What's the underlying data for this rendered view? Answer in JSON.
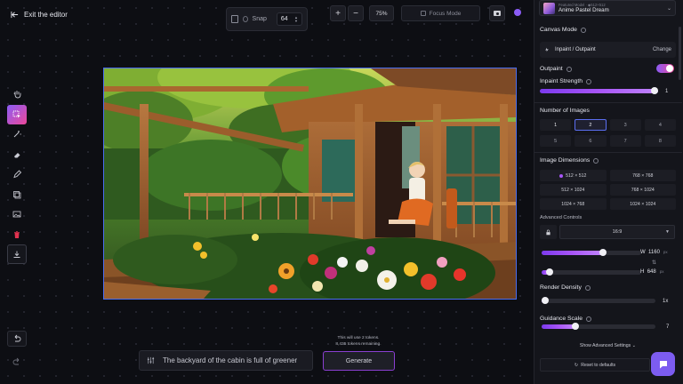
{
  "topbar": {
    "exit_label": "Exit the editor",
    "snap_label": "Snap",
    "snap_value": "64",
    "zoom_in": "+",
    "zoom_out": "−",
    "zoom_level": "75%",
    "focus_mode": "Focus Mode"
  },
  "model": {
    "meta": "Featured Model · ◆512×512",
    "name": "Anime Pastel Dream"
  },
  "canvas_mode": {
    "title": "Canvas Mode",
    "mode": "Inpaint / Outpaint",
    "change": "Change"
  },
  "outpaint": {
    "label": "Outpaint",
    "enabled": true
  },
  "inpaint_strength": {
    "label": "Inpaint Strength",
    "value": "1",
    "level": 1.0
  },
  "num_images": {
    "title": "Number of Images",
    "options": [
      "1",
      "2",
      "3",
      "4",
      "5",
      "6",
      "7",
      "8"
    ],
    "selected": "2"
  },
  "image_dims": {
    "title": "Image Dimensions",
    "options": [
      "512 × 512",
      "768 × 768",
      "512 × 1024",
      "768 × 1024",
      "1024 × 768",
      "1024 × 1024"
    ],
    "selected": "512 × 512"
  },
  "advanced": {
    "label": "Advanced Controls",
    "ratio": "16:9",
    "width_label": "W",
    "width_value": "1160",
    "height_label": "H",
    "height_value": "648",
    "unit": "px",
    "width_level": 0.62,
    "height_level": 0.08
  },
  "render_density": {
    "label": "Render Density",
    "value": "1x",
    "level": 0.0
  },
  "guidance_scale": {
    "label": "Guidance Scale",
    "value": "7",
    "level": 0.3
  },
  "show_advanced": "Show Advanced Settings",
  "reset": "Reset to defaults",
  "prompt": {
    "text": "The backyard of the cabin is full of greener"
  },
  "tokens": {
    "line1": "This will use 2 tokens.",
    "line2": "8,435 tokens remaining."
  },
  "generate": "Generate",
  "colors": {
    "accent": "#8b5cf6",
    "accent2": "#ec4899",
    "selection": "#4a6df0"
  }
}
